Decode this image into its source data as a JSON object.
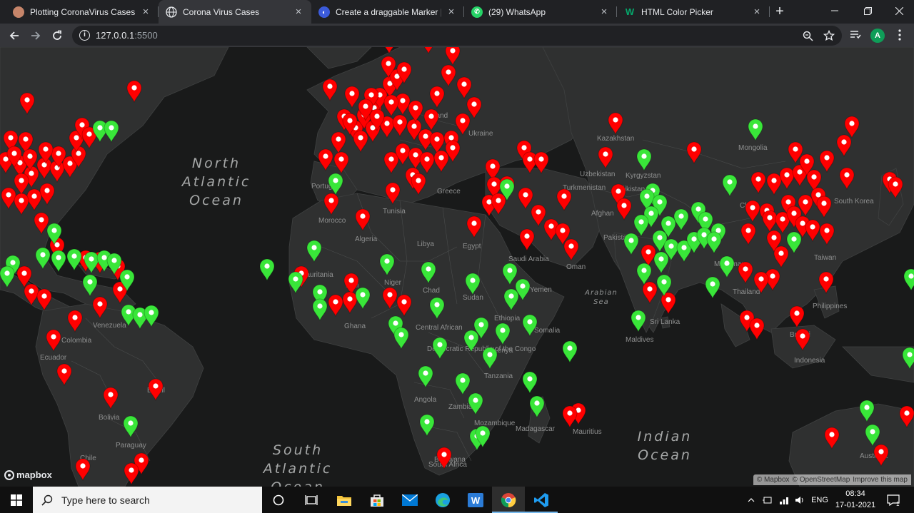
{
  "browser": {
    "tabs": [
      {
        "title": "Plotting CoronaVirus Cases On",
        "active": false,
        "favicon": "person-avatar-icon",
        "color": "#c6856a"
      },
      {
        "title": "Corona Virus Cases",
        "active": true,
        "favicon": "globe-icon",
        "color": "#e8eaed"
      },
      {
        "title": "Create a draggable Marker | M",
        "active": false,
        "favicon": "codesandbox-icon",
        "color": "#3b5bdb"
      },
      {
        "title": "(29) WhatsApp",
        "active": false,
        "favicon": "whatsapp-icon",
        "color": "#25d366"
      },
      {
        "title": "HTML Color Picker",
        "active": false,
        "favicon": "w3schools-icon",
        "color": "#04aa6d"
      }
    ],
    "new_tab": "+",
    "url_host": "127.0.0.1",
    "url_port": ":5500",
    "profile_initial": "A"
  },
  "map": {
    "oceans": [
      {
        "text": "North\nAtlantic\nOcean"
      },
      {
        "text": "South\nAtlantic\nOcean"
      },
      {
        "text": "Indian\nOcean"
      }
    ],
    "seas": [
      {
        "text": "Arabian\nSea"
      }
    ],
    "countries": [
      "Kazakhstan",
      "Uzbekistan",
      "Kyrgyzstan",
      "Turkmenistan",
      "Tajikistan",
      "Afghan",
      "Pakistan",
      "Mongolia",
      "China",
      "South Korea",
      "Taiwan",
      "Myanmar",
      "Thailand",
      "Philippines",
      "Indonesia",
      "Brunei",
      "Sri Lanka",
      "Maldives",
      "Yemen",
      "Saudi Arabia",
      "Oman",
      "Egypt",
      "Libya",
      "Tunisia",
      "Algeria",
      "Morocco",
      "Portugal",
      "Greece",
      "Ukraine",
      "Poland",
      "Mauritania",
      "Mali",
      "Niger",
      "Chad",
      "Sudan",
      "Ethiopia",
      "Somalia",
      "Kenya",
      "Tanzania",
      "Central African",
      "Democratic Republic of the Congo",
      "Angola",
      "Zambia",
      "Mozambique",
      "Madagascar",
      "Botswana",
      "South Africa",
      "Mauritius",
      "Australia",
      "Colombia",
      "Venezuela",
      "Ecuador",
      "Brazil",
      "Bolivia",
      "Paraguay",
      "Chile",
      "Ghana"
    ],
    "markers": {
      "red_color": "#ff0000",
      "green_color": "#39e639"
    },
    "logo": "mapbox",
    "attribution": [
      "© Mapbox",
      "© OpenStreetMap",
      "Improve this map"
    ]
  },
  "taskbar": {
    "search_placeholder": "Type here to search",
    "language": "ENG",
    "time": "08:34",
    "date": "17-01-2021",
    "notification_count": "1",
    "pinned": [
      "task-view-icon",
      "file-explorer-icon",
      "microsoft-store-icon",
      "mail-icon",
      "edge-icon",
      "writer-icon",
      "chrome-icon",
      "vscode-icon"
    ]
  }
}
